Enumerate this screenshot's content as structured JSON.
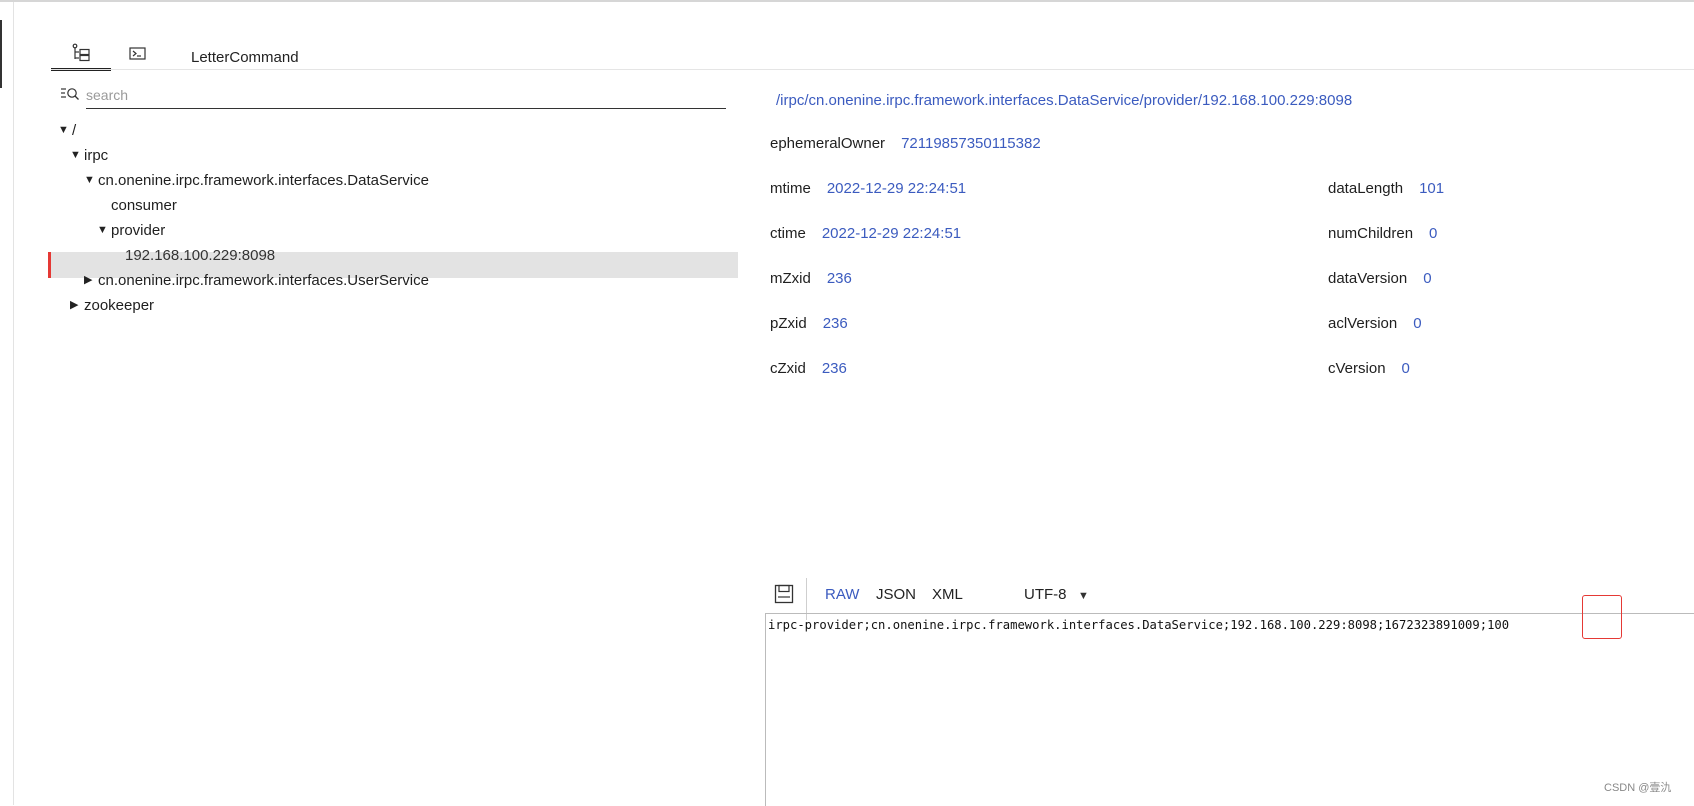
{
  "tabs": {
    "tree_icon": "tree-icon",
    "terminal_icon": "terminal-icon",
    "letter_label": "LetterCommand"
  },
  "search": {
    "placeholder": "search"
  },
  "tree": {
    "root": "/",
    "irpc": "irpc",
    "data_service": "cn.onenine.irpc.framework.interfaces.DataService",
    "consumer": "consumer",
    "provider": "provider",
    "provider_node": "192.168.100.229:8098",
    "user_service": "cn.onenine.irpc.framework.interfaces.UserService",
    "zookeeper": "zookeeper"
  },
  "detail": {
    "path": "/irpc/cn.onenine.irpc.framework.interfaces.DataService/provider/192.168.100.229:8098",
    "ephemeral_owner_label": "ephemeralOwner",
    "ephemeral_owner_value": "72119857350115382",
    "mtime_label": "mtime",
    "mtime_value": "2022-12-29 22:24:51",
    "ctime_label": "ctime",
    "ctime_value": "2022-12-29 22:24:51",
    "mzxid_label": "mZxid",
    "mzxid_value": "236",
    "pzxid_label": "pZxid",
    "pzxid_value": "236",
    "czxid_label": "cZxid",
    "czxid_value": "236",
    "data_length_label": "dataLength",
    "data_length_value": "101",
    "num_children_label": "numChildren",
    "num_children_value": "0",
    "data_version_label": "dataVersion",
    "data_version_value": "0",
    "acl_version_label": "aclVersion",
    "acl_version_value": "0",
    "c_version_label": "cVersion",
    "c_version_value": "0"
  },
  "data_toolbar": {
    "save_icon": "save-icon",
    "raw": "RAW",
    "json": "JSON",
    "xml": "XML",
    "encoding": "UTF-8"
  },
  "data_content": {
    "text": "irpc-provider;cn.onenine.irpc.framework.interfaces.DataService;192.168.100.229:8098;1672323891009;100"
  },
  "watermark": "CSDN @壹氿",
  "colors": {
    "accent_blue": "#3b5bbf",
    "selection_red": "#e53935"
  }
}
